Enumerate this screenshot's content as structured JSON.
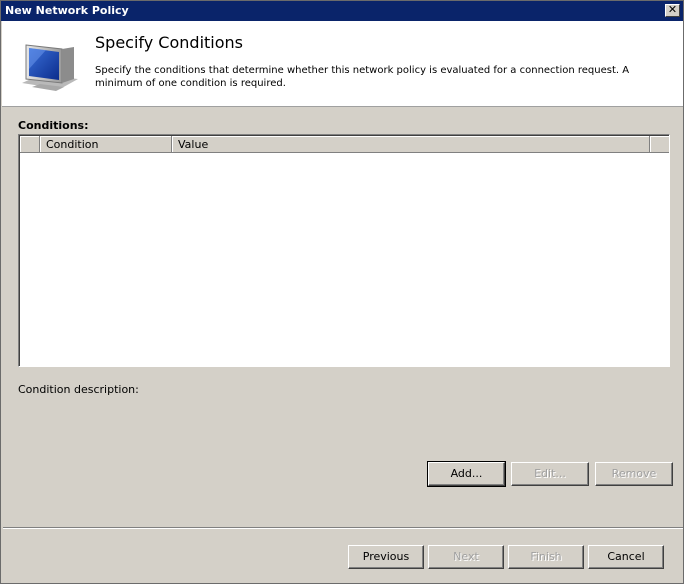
{
  "window": {
    "title": "New Network Policy",
    "close_glyph": "✕"
  },
  "header": {
    "title": "Specify Conditions",
    "description": "Specify the conditions that determine whether this network policy is evaluated for a connection request. A minimum of one condition is required.",
    "icon": "computer-monitor-icon"
  },
  "conditions": {
    "label": "Conditions:",
    "columns": [
      "Condition",
      "Value"
    ],
    "rows": []
  },
  "condition_description": {
    "label": "Condition description:"
  },
  "actions": {
    "add": "Add...",
    "edit": "Edit...",
    "remove": "Remove"
  },
  "footer": {
    "previous": "Previous",
    "next": "Next",
    "finish": "Finish",
    "cancel": "Cancel"
  }
}
